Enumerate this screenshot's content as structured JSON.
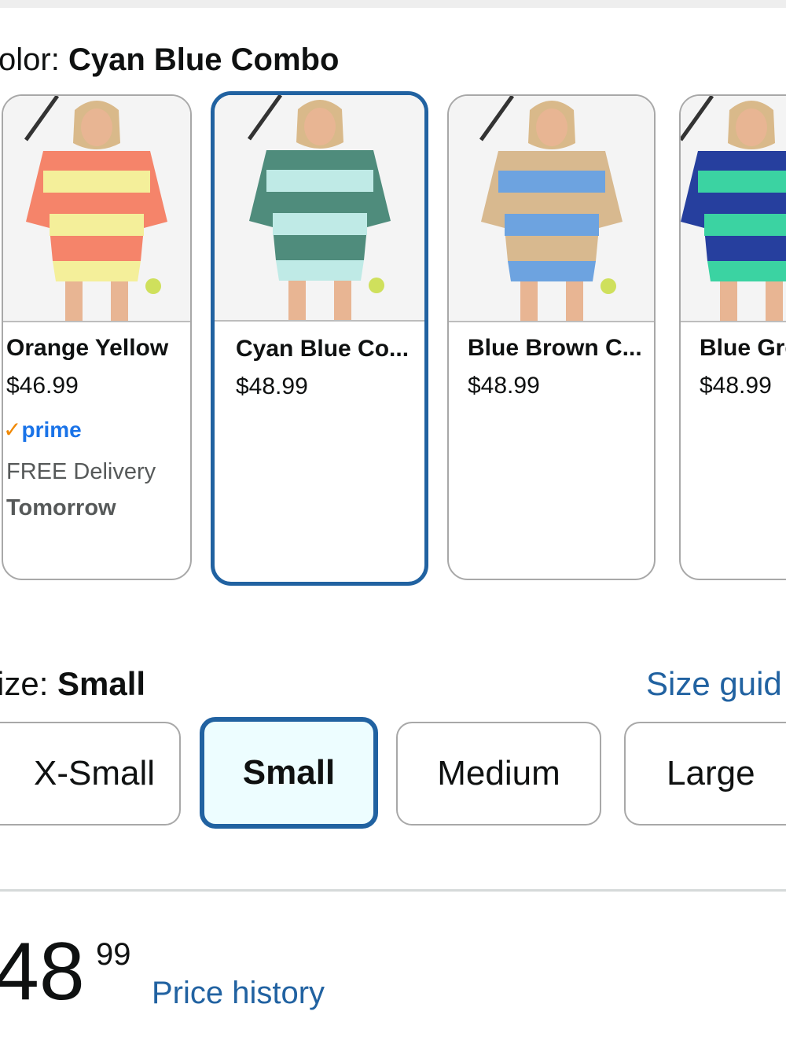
{
  "color": {
    "label": "olor:",
    "selected": "Cyan Blue Combo",
    "swatches": [
      {
        "name": "Orange Yellow",
        "price": "$46.99",
        "prime": "prime",
        "delivery": "FREE Delivery",
        "delivery_day": "Tomorrow",
        "colors": {
          "primary": "#f5846a",
          "secondary": "#f4ef9a",
          "skin": "#e8b593"
        }
      },
      {
        "name": "Cyan Blue Co...",
        "price": "$48.99",
        "colors": {
          "primary": "#4f8c7c",
          "secondary": "#bfeae6",
          "skin": "#e8b593"
        }
      },
      {
        "name": "Blue Brown C...",
        "price": "$48.99",
        "colors": {
          "primary": "#d8b98f",
          "secondary": "#6da3e0",
          "skin": "#e8b593"
        }
      },
      {
        "name": "Blue Gre",
        "price": "$48.99",
        "colors": {
          "primary": "#263f9e",
          "secondary": "#3bd3a2",
          "skin": "#e8b593"
        }
      }
    ]
  },
  "size": {
    "label": "ize:",
    "selected": "Small",
    "guide_link": "Size guid",
    "options": [
      "X-Small",
      "Small",
      "Medium",
      "Large"
    ]
  },
  "price": {
    "whole": "48",
    "fraction": "99",
    "history_link": "Price history"
  },
  "accent_colors": {
    "link": "#2162a1",
    "selected_border": "#2162a1",
    "prime": "#1a73e8",
    "prime_check": "#f08804"
  }
}
